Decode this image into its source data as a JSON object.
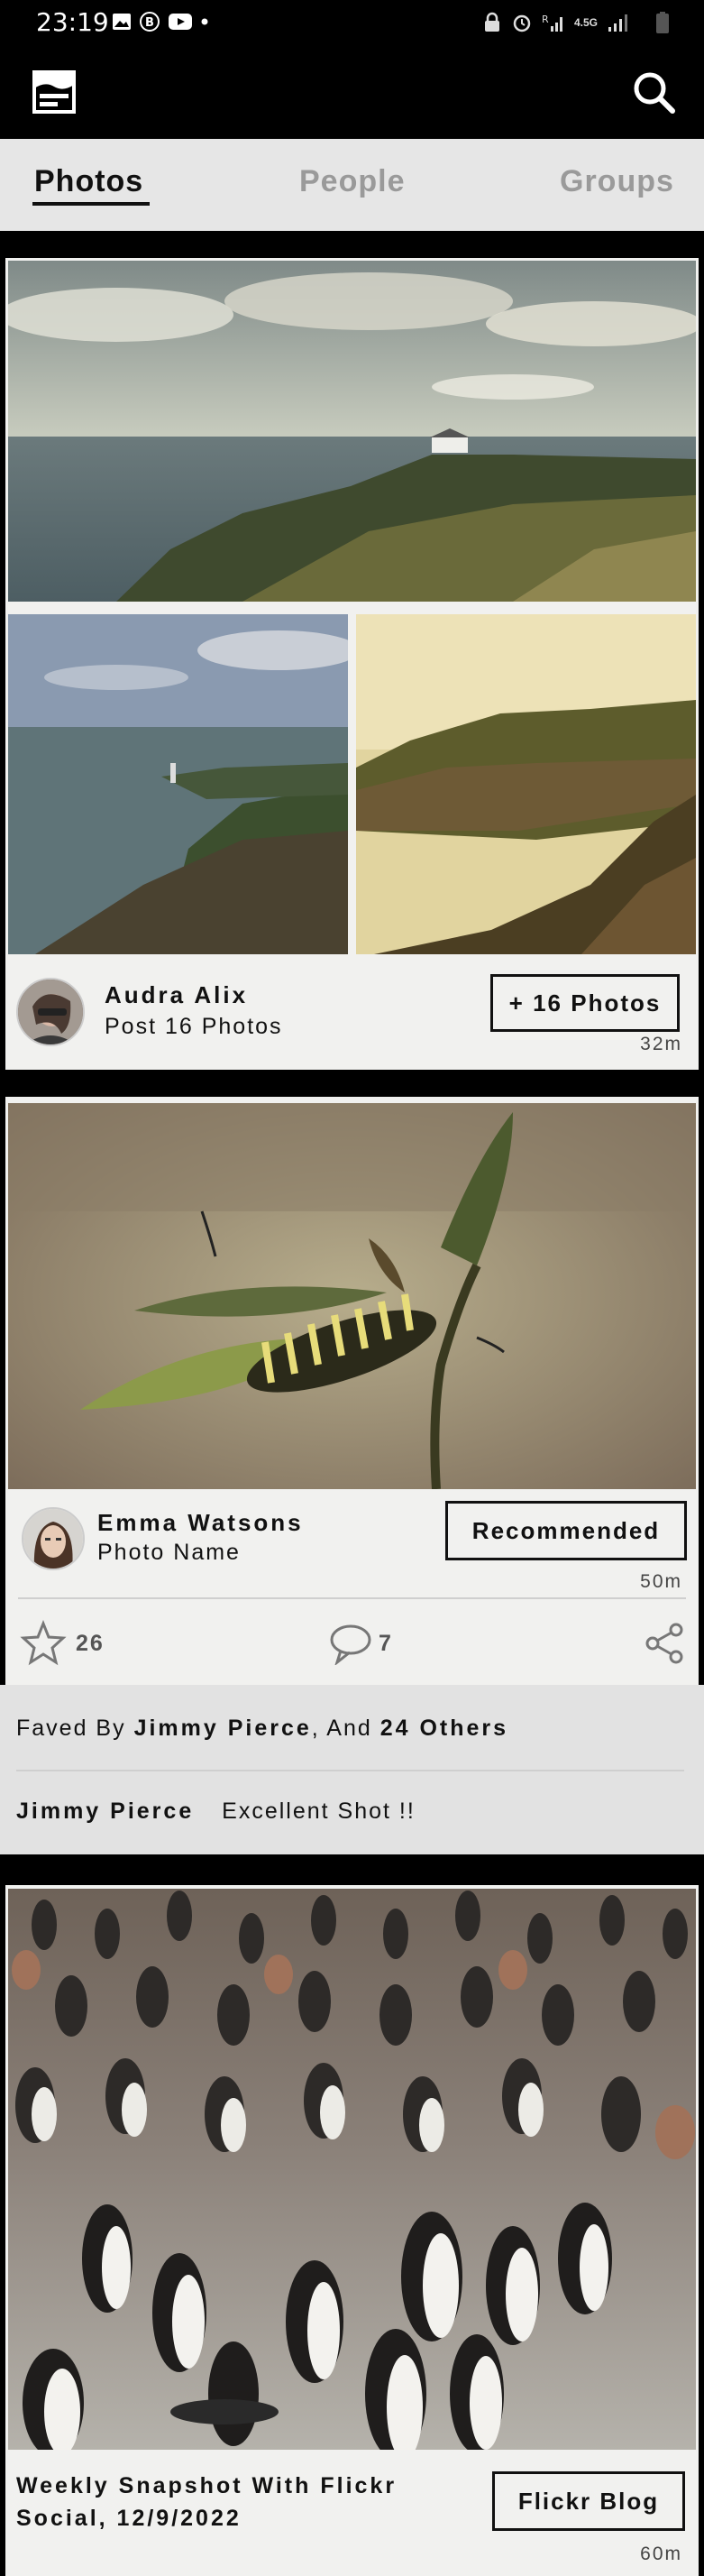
{
  "status_bar": {
    "time": "23:19",
    "network": "4.5G"
  },
  "tabs": [
    {
      "label": "Photos"
    },
    {
      "label": "People"
    },
    {
      "label": "Groups"
    }
  ],
  "posts": [
    {
      "author": "Audra  Alix",
      "caption": "Post 16 Photos",
      "button": "+ 16 Photos",
      "time": "32m"
    },
    {
      "author": "Emma  Watsons",
      "caption": "Photo Name",
      "button": "Recommended",
      "time": "50m",
      "stars": "26",
      "comments": "7",
      "faved_prefix": "Faved By",
      "faved_user": "Jimmy  Pierce",
      "faved_mid": ", And",
      "faved_count": "24 Others",
      "comment_user": "Jimmy  Pierce",
      "comment_text": "Excellent Shot !!"
    },
    {
      "title_line1": "Weekly Snapshot With Flickr",
      "title_line2": "Social, 12/9/2022",
      "button": "Flickr Blog",
      "time": "60m"
    }
  ]
}
